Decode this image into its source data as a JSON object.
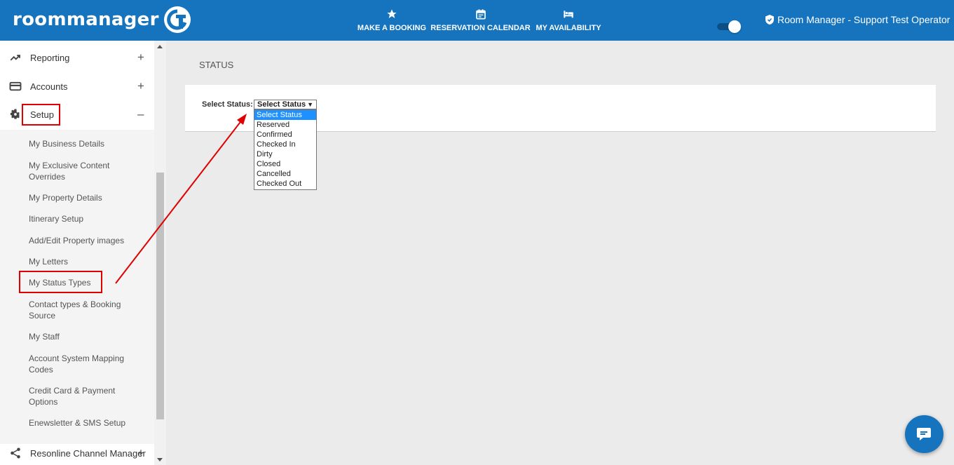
{
  "header": {
    "logo_text": "roommanager",
    "nav": [
      {
        "label": "MAKE A BOOKING",
        "icon": "star-icon"
      },
      {
        "label": "RESERVATION CALENDAR",
        "icon": "calendar-icon"
      },
      {
        "label": "MY AVAILABILITY",
        "icon": "bed-icon"
      }
    ],
    "user_label": "Room Manager - Support Test Operator",
    "brand_color": "#1574bd"
  },
  "sidebar": {
    "items": [
      {
        "label": "Reporting",
        "icon": "trending-up-icon",
        "toggle": "+"
      },
      {
        "label": "Accounts",
        "icon": "card-icon",
        "toggle": "+"
      },
      {
        "label": "Setup",
        "icon": "gear-icon",
        "toggle": "–"
      },
      {
        "label": "Resonline Channel Manager",
        "icon": "share-icon",
        "toggle": "+"
      }
    ],
    "setup_subitems": [
      "My Business Details",
      "My Exclusive Content Overrides",
      "My Property Details",
      "Itinerary Setup",
      "Add/Edit Property images",
      "My Letters",
      "My Status Types",
      "Contact types & Booking Source",
      "My Staff",
      "Account System Mapping Codes",
      "Credit Card & Payment Options",
      "Enewsletter & SMS Setup"
    ]
  },
  "main": {
    "title": "STATUS",
    "select_label": "Select Status:",
    "select_value": "Select Status",
    "options": [
      "Select Status",
      "Reserved",
      "Confirmed",
      "Checked In",
      "Dirty",
      "Closed",
      "Cancelled",
      "Checked Out"
    ]
  },
  "colors": {
    "highlight": "#e00000",
    "selected_option": "#1e90ff"
  }
}
